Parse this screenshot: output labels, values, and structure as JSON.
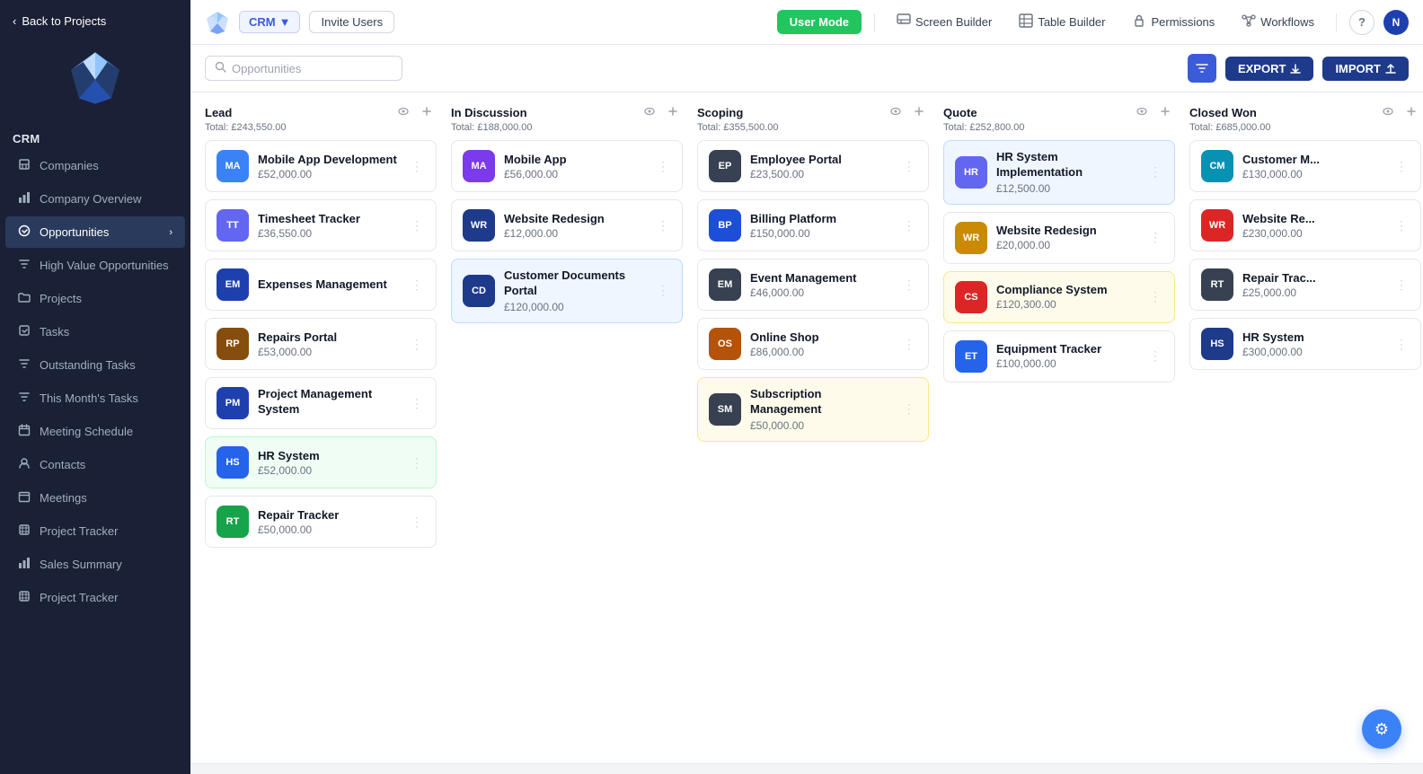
{
  "sidebar": {
    "back_label": "Back to Projects",
    "section_label": "CRM",
    "items": [
      {
        "id": "companies",
        "label": "Companies",
        "icon": "building-icon",
        "active": false
      },
      {
        "id": "company-overview",
        "label": "Company Overview",
        "icon": "chart-icon",
        "active": false
      },
      {
        "id": "opportunities",
        "label": "Opportunities",
        "icon": "opportunity-icon",
        "active": true,
        "has_chevron": true
      },
      {
        "id": "high-value",
        "label": "High Value Opportunities",
        "icon": "filter-icon",
        "active": false
      },
      {
        "id": "projects",
        "label": "Projects",
        "icon": "folder-icon",
        "active": false
      },
      {
        "id": "tasks",
        "label": "Tasks",
        "icon": "task-icon",
        "active": false
      },
      {
        "id": "outstanding-tasks",
        "label": "Outstanding Tasks",
        "icon": "filter-icon2",
        "active": false
      },
      {
        "id": "this-month-tasks",
        "label": "This Month's Tasks",
        "icon": "filter-icon3",
        "active": false
      },
      {
        "id": "meeting-schedule",
        "label": "Meeting Schedule",
        "icon": "calendar-icon",
        "active": false
      },
      {
        "id": "contacts",
        "label": "Contacts",
        "icon": "contacts-icon",
        "active": false
      },
      {
        "id": "meetings",
        "label": "Meetings",
        "icon": "meetings-icon",
        "active": false
      },
      {
        "id": "project-tracker",
        "label": "Project Tracker",
        "icon": "tracker-icon",
        "active": false
      },
      {
        "id": "sales-summary",
        "label": "Sales Summary",
        "icon": "sales-icon",
        "active": false
      },
      {
        "id": "project-tracker2",
        "label": "Project Tracker",
        "icon": "tracker-icon2",
        "active": false
      }
    ]
  },
  "topbar": {
    "crm_label": "CRM",
    "invite_label": "Invite Users",
    "user_mode_label": "User Mode",
    "screen_builder_label": "Screen Builder",
    "table_builder_label": "Table Builder",
    "permissions_label": "Permissions",
    "workflows_label": "Workflows",
    "help_label": "?",
    "avatar_label": "N"
  },
  "toolbar": {
    "search_placeholder": "Opportunities",
    "export_label": "EXPORT",
    "import_label": "IMPORT"
  },
  "columns": [
    {
      "id": "lead",
      "title": "Lead",
      "total": "Total: £243,550.00",
      "cards": [
        {
          "id": 1,
          "name": "Mobile App Development",
          "value": "£52,000.00",
          "avatar_text": "MA",
          "avatar_bg": "#3b82f6",
          "tint": ""
        },
        {
          "id": 2,
          "name": "Timesheet Tracker",
          "value": "£36,550.00",
          "avatar_text": "TT",
          "avatar_bg": "#6366f1",
          "tint": ""
        },
        {
          "id": 3,
          "name": "Expenses Management",
          "value": "",
          "avatar_text": "EM",
          "avatar_bg": "#1e40af",
          "tint": ""
        },
        {
          "id": 4,
          "name": "Repairs Portal",
          "value": "£53,000.00",
          "avatar_text": "RP",
          "avatar_bg": "#854d0e",
          "tint": ""
        },
        {
          "id": 5,
          "name": "Project Management System",
          "value": "",
          "avatar_text": "PM",
          "avatar_bg": "#1e40af",
          "tint": ""
        },
        {
          "id": 6,
          "name": "HR System",
          "value": "£52,000.00",
          "avatar_text": "HS",
          "avatar_bg": "#2563eb",
          "tint": "green-tint"
        },
        {
          "id": 7,
          "name": "Repair Tracker",
          "value": "£50,000.00",
          "avatar_text": "RT",
          "avatar_bg": "#16a34a",
          "tint": ""
        }
      ]
    },
    {
      "id": "in-discussion",
      "title": "In Discussion",
      "total": "Total: £188,000.00",
      "cards": [
        {
          "id": 8,
          "name": "Mobile App",
          "value": "£56,000.00",
          "avatar_text": "MA",
          "avatar_bg": "#7c3aed",
          "tint": ""
        },
        {
          "id": 9,
          "name": "Website Redesign",
          "value": "£12,000.00",
          "avatar_text": "WR",
          "avatar_bg": "#1e3a8a",
          "tint": ""
        },
        {
          "id": 10,
          "name": "Customer Documents Portal",
          "value": "£120,000.00",
          "avatar_text": "CD",
          "avatar_bg": "#1e3a8a",
          "tint": "blue-tint"
        }
      ]
    },
    {
      "id": "scoping",
      "title": "Scoping",
      "total": "Total: £355,500.00",
      "cards": [
        {
          "id": 11,
          "name": "Employee Portal",
          "value": "£23,500.00",
          "avatar_text": "EP",
          "avatar_bg": "#374151",
          "tint": ""
        },
        {
          "id": 12,
          "name": "Billing Platform",
          "value": "£150,000.00",
          "avatar_text": "BP",
          "avatar_bg": "#1d4ed8",
          "tint": ""
        },
        {
          "id": 13,
          "name": "Event Management",
          "value": "£46,000.00",
          "avatar_text": "EM",
          "avatar_bg": "#374151",
          "tint": ""
        },
        {
          "id": 14,
          "name": "Online Shop",
          "value": "£86,000.00",
          "avatar_text": "OS",
          "avatar_bg": "#b45309",
          "tint": ""
        },
        {
          "id": 15,
          "name": "Subscription Management",
          "value": "£50,000.00",
          "avatar_text": "SM",
          "avatar_bg": "#374151",
          "tint": "yellow-tint"
        }
      ]
    },
    {
      "id": "quote",
      "title": "Quote",
      "total": "Total: £252,800.00",
      "cards": [
        {
          "id": 16,
          "name": "HR System Implementation",
          "value": "£12,500.00",
          "avatar_text": "HR",
          "avatar_bg": "#6366f1",
          "tint": "blue-tint"
        },
        {
          "id": 17,
          "name": "Website Redesign",
          "value": "£20,000.00",
          "avatar_text": "WR",
          "avatar_bg": "#ca8a04",
          "tint": ""
        },
        {
          "id": 18,
          "name": "Compliance System",
          "value": "£120,300.00",
          "avatar_text": "CS",
          "avatar_bg": "#dc2626",
          "tint": "yellow-tint"
        },
        {
          "id": 19,
          "name": "Equipment Tracker",
          "value": "£100,000.00",
          "avatar_text": "ET",
          "avatar_bg": "#2563eb",
          "tint": ""
        }
      ]
    },
    {
      "id": "closed-won",
      "title": "Closed Won",
      "total": "Total: £685,000.00",
      "cards": [
        {
          "id": 20,
          "name": "Customer M...",
          "value": "£130,000.00",
          "avatar_text": "CM",
          "avatar_bg": "#0891b2",
          "tint": ""
        },
        {
          "id": 21,
          "name": "Website Re...",
          "value": "£230,000.00",
          "avatar_text": "WR",
          "avatar_bg": "#dc2626",
          "tint": ""
        },
        {
          "id": 22,
          "name": "Repair Trac...",
          "value": "£25,000.00",
          "avatar_text": "RT",
          "avatar_bg": "#374151",
          "tint": ""
        },
        {
          "id": 23,
          "name": "HR System",
          "value": "£300,000.00",
          "avatar_text": "HS",
          "avatar_bg": "#1e3a8a",
          "tint": ""
        }
      ]
    }
  ],
  "fab": {
    "icon": "⚙"
  }
}
